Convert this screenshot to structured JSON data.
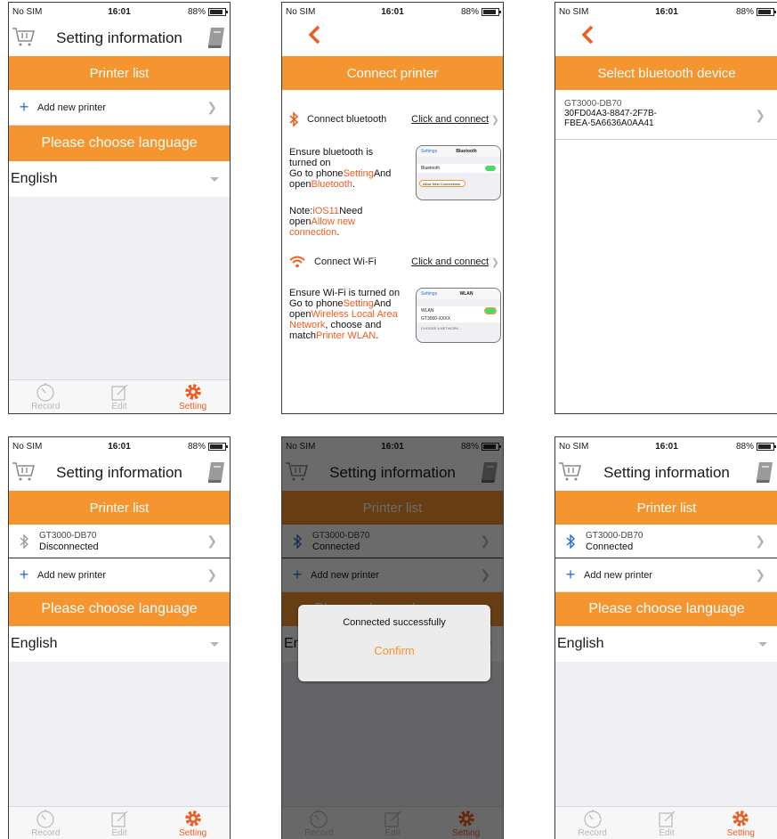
{
  "status": {
    "carrier": "No SIM",
    "time": "16:01",
    "battery": "88%"
  },
  "setting": {
    "title": "Setting information",
    "printer_list": "Printer list",
    "add_printer": "Add new printer",
    "choose_language": "Please choose language",
    "language": "English",
    "printer_name": "GT3000-DB70",
    "state_disconnected": "Disconnected",
    "state_connected": "Connected"
  },
  "tabs": [
    {
      "label": "Record",
      "icon": "clock-icon"
    },
    {
      "label": "Edit",
      "icon": "edit-icon"
    },
    {
      "label": "Setting",
      "icon": "gear-icon"
    }
  ],
  "connect": {
    "header": "Connect printer",
    "bt_label": "Connect bluetooth",
    "bt_link": "Click and connect",
    "bt_l1": "Ensure bluetooth is",
    "bt_l2": "turned on",
    "bt_l3a": "Go to phone",
    "bt_l3b": "Setting",
    "bt_l3c": "And",
    "bt_l4a": "open",
    "bt_l4b": "Bluetooth",
    "bt_l4c": ".",
    "note_a": "Note:",
    "note_b": "iOS11",
    "note_c": "Need",
    "note_d": "open",
    "note_e": "Allow new",
    "note_f": "connection",
    "note_g": ".",
    "wifi_label": "Connect Wi-Fi",
    "wifi_link": "Click and connect",
    "wf_l1": "Ensure Wi-Fi is turned on",
    "wf_l2a": "Go to phone",
    "wf_l2b": "Setting",
    "wf_l2c": "And",
    "wf_l3a": "open",
    "wf_l3b": "Wireless Local Area",
    "wf_l4a": "Network",
    "wf_l4b": ", choose and",
    "wf_l5a": "match",
    "wf_l5b": "Printer WLAN",
    "wf_l5c": ".",
    "shot_bt_back": "Settings",
    "shot_bt_title": "Bluetooth",
    "shot_bt_row": "Bluetooth",
    "shot_bt_allow": "Allow New Connections",
    "shot_wf_back": "Settings",
    "shot_wf_title": "WLAN",
    "shot_wf_row": "WLAN",
    "shot_wf_net": "GT3000-XXXX",
    "shot_wf_choose": "CHOOSE A NETWORK..."
  },
  "bluetooth_select": {
    "header": "Select bluetooth device",
    "device_name": "GT3000-DB70",
    "device_id_1": "30FD04A3-8847-2F7B-",
    "device_id_2": "FBEA-5A6636A0AA41"
  },
  "dialog": {
    "message": "Connected successfully",
    "confirm": "Confirm"
  },
  "colors": {
    "accent": "#f5952f",
    "highlight": "#f25b1f",
    "link_blue": "#2b6fd6"
  }
}
